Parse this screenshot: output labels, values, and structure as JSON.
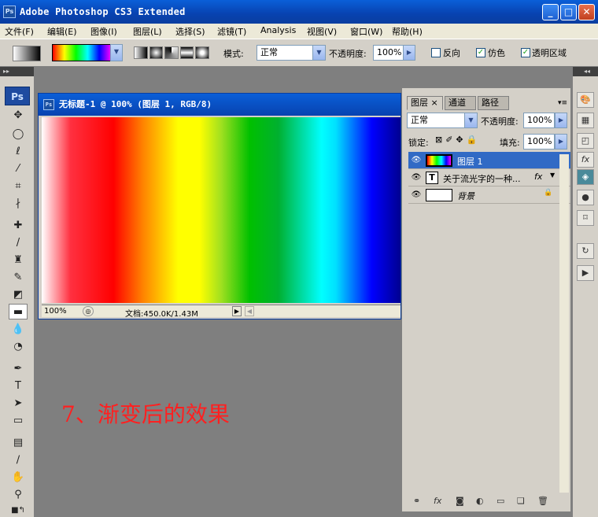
{
  "window": {
    "title": "Adobe Photoshop CS3 Extended",
    "app_icon": "Ps"
  },
  "menu": [
    "文件(F)",
    "编辑(E)",
    "图像(I)",
    "图层(L)",
    "选择(S)",
    "滤镜(T)",
    "Analysis",
    "视图(V)",
    "窗口(W)",
    "帮助(H)"
  ],
  "options": {
    "mode_label": "模式:",
    "mode_value": "正常",
    "opacity_label": "不透明度:",
    "opacity_value": "100%",
    "reverse_label": "反向",
    "dither_label": "仿色",
    "transparency_label": "透明区域"
  },
  "tools": {
    "logo": "Ps"
  },
  "document": {
    "title": "无标题-1 @ 100% (图层 1, RGB/8)",
    "zoom": "100%",
    "doc_info": "文档:450.0K/1.43M"
  },
  "caption": "7、渐变后的效果",
  "layers_panel": {
    "tabs": [
      "图层",
      "通道",
      "路径"
    ],
    "blend_mode": "正常",
    "opacity_label": "不透明度:",
    "opacity_value": "100%",
    "lock_label": "锁定:",
    "fill_label": "填充:",
    "fill_value": "100%",
    "layers": [
      {
        "name": "图层 1",
        "selected": true
      },
      {
        "name": "关于流光字的一种...",
        "selected": false
      },
      {
        "name": "背景",
        "selected": false
      }
    ]
  },
  "colors": {
    "titlebar": "#0842b0",
    "selection": "#316ac5",
    "caption": "#ff2020"
  }
}
